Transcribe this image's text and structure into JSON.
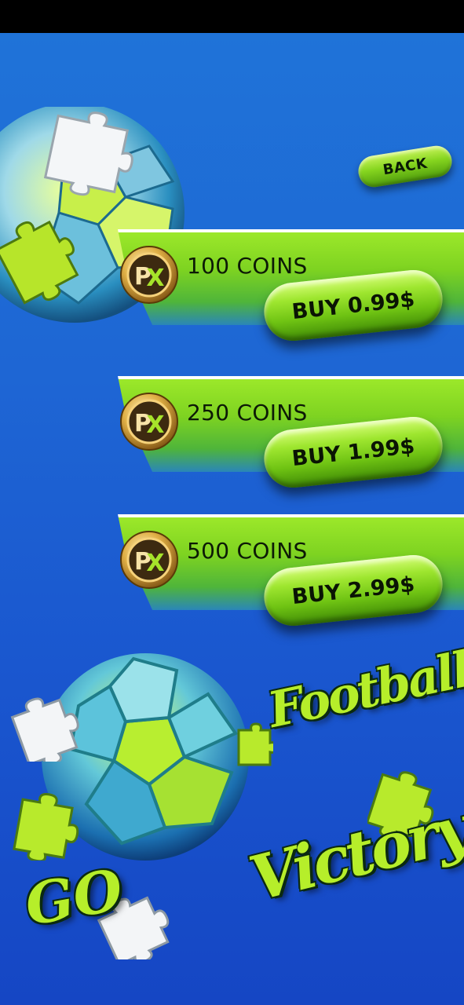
{
  "header": {
    "back_label": "BACK"
  },
  "offers": [
    {
      "coin_icon": "px-coin-icon",
      "title": "100 COINS",
      "buy_label": "BUY 0.99$"
    },
    {
      "coin_icon": "px-coin-icon",
      "title": "250 COINS",
      "buy_label": "BUY 1.99$"
    },
    {
      "coin_icon": "px-coin-icon",
      "title": "500 COINS",
      "buy_label": "BUY 2.99$"
    }
  ],
  "coin": {
    "glyph_p": "P",
    "glyph_x": "X"
  },
  "decor": {
    "text_football": "Football",
    "text_victory": "Victory",
    "text_go": "GO"
  },
  "colors": {
    "background_top": "#1f73d8",
    "background_bottom": "#1546c4",
    "accent_green": "#7ed321",
    "graffiti_green": "#b6ee2a"
  }
}
